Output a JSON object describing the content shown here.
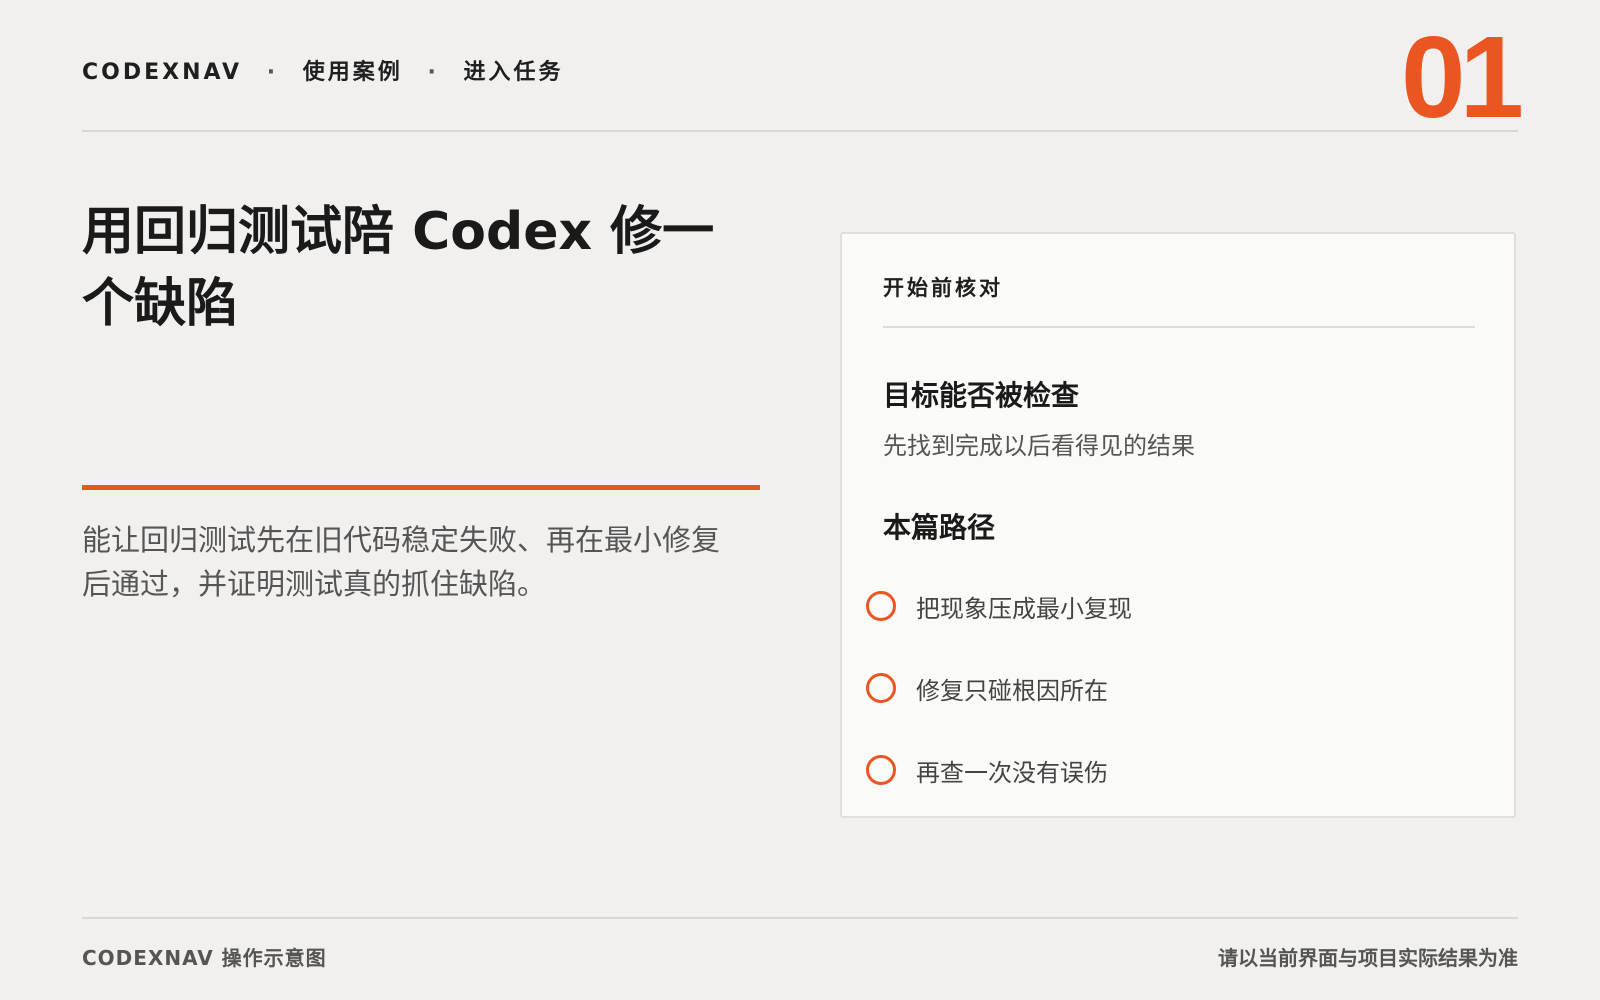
{
  "header": {
    "breadcrumb": [
      "CODEXNAV",
      "使用案例",
      "进入任务"
    ],
    "separator": "·",
    "page_number": "01"
  },
  "main": {
    "title": "用回归测试陪 Codex 修一个缺陷",
    "description": "能让回归测试先在旧代码稳定失败、再在最小修复后通过，并证明测试真的抓住缺陷。"
  },
  "checklist": {
    "title": "开始前核对",
    "goal_heading": "目标能否被检查",
    "goal_text": "先找到完成以后看得见的结果",
    "path_heading": "本篇路径",
    "steps": [
      "把现象压成最小复现",
      "修复只碰根因所在",
      "再查一次没有误伤"
    ]
  },
  "footer": {
    "left": "CODEXNAV 操作示意图",
    "right": "请以当前界面与项目实际结果为准"
  },
  "colors": {
    "accent": "#eb5521",
    "background": "#f1f0ee",
    "card": "#fafaf8"
  }
}
